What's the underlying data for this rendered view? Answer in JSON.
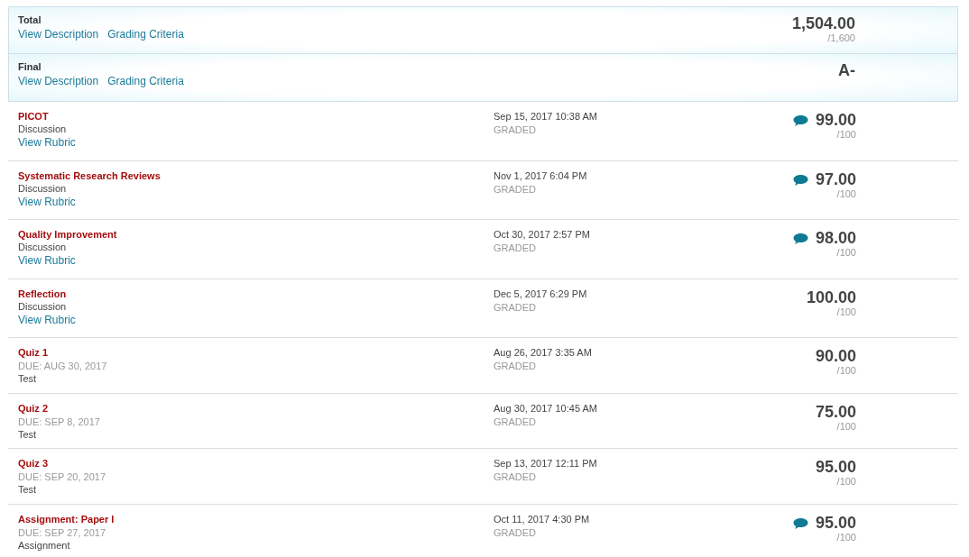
{
  "summary": [
    {
      "label": "Total",
      "links": [
        "View Description",
        "Grading Criteria"
      ],
      "score": "1,504.00",
      "out_of": "/1,600"
    },
    {
      "label": "Final",
      "links": [
        "View Description",
        "Grading Criteria"
      ],
      "score": "A-"
    }
  ],
  "items": [
    {
      "title": "PICOT",
      "type": "Discussion",
      "rubric": "View Rubric",
      "date": "Sep 15, 2017 10:38 AM",
      "status": "GRADED",
      "comment": true,
      "score": "99.00",
      "out_of": "/100"
    },
    {
      "title": "Systematic Research Reviews",
      "type": "Discussion",
      "rubric": "View Rubric",
      "date": "Nov 1, 2017 6:04 PM",
      "status": "GRADED",
      "comment": true,
      "score": "97.00",
      "out_of": "/100"
    },
    {
      "title": "Quality Improvement",
      "type": "Discussion",
      "rubric": "View Rubric",
      "date": "Oct 30, 2017 2:57 PM",
      "status": "GRADED",
      "comment": true,
      "score": "98.00",
      "out_of": "/100"
    },
    {
      "title": "Reflection",
      "type": "Discussion",
      "rubric": "View Rubric",
      "date": "Dec 5, 2017 6:29 PM",
      "status": "GRADED",
      "comment": false,
      "score": "100.00",
      "out_of": "/100"
    },
    {
      "title": "Quiz 1",
      "due": "DUE: AUG 30, 2017",
      "type": "Test",
      "date": "Aug 26, 2017 3:35 AM",
      "status": "GRADED",
      "comment": false,
      "score": "90.00",
      "out_of": "/100"
    },
    {
      "title": "Quiz 2",
      "due": "DUE: SEP 8, 2017",
      "type": "Test",
      "date": "Aug 30, 2017 10:45 AM",
      "status": "GRADED",
      "comment": false,
      "score": "75.00",
      "out_of": "/100"
    },
    {
      "title": "Quiz 3",
      "due": "DUE: SEP 20, 2017",
      "type": "Test",
      "date": "Sep 13, 2017 12:11 PM",
      "status": "GRADED",
      "comment": false,
      "score": "95.00",
      "out_of": "/100"
    },
    {
      "title": "Assignment: Paper I",
      "due": "DUE: SEP 27, 2017",
      "type": "Assignment",
      "date": "Oct 11, 2017 4:30 PM",
      "status": "GRADED",
      "comment": true,
      "score": "95.00",
      "out_of": "/100"
    }
  ]
}
